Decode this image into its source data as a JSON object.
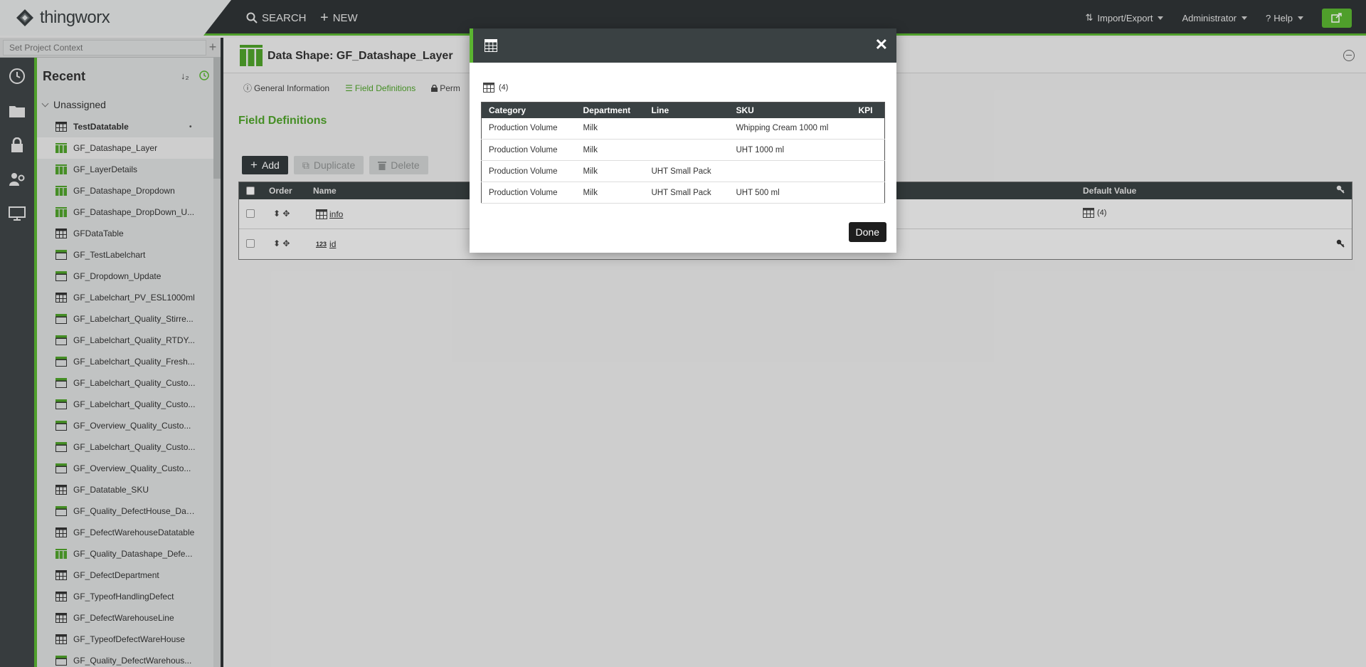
{
  "topbar": {
    "brand": "thingworx",
    "search_label": "SEARCH",
    "new_label": "NEW",
    "import_export_label": "Import/Export",
    "user_label": "Administrator",
    "help_label": "Help",
    "accent_color": "#5bb531"
  },
  "context": {
    "placeholder": "Set Project Context"
  },
  "recent": {
    "title": "Recent",
    "sort_label": "↓₂",
    "group_label": "Unassigned",
    "items": [
      {
        "label": "TestDatatable",
        "icon": "table-icon",
        "bold": true
      },
      {
        "label": "GF_Datashape_Layer",
        "icon": "datashape-icon",
        "selected": true
      },
      {
        "label": "GF_LayerDetails",
        "icon": "datashape-icon"
      },
      {
        "label": "GF_Datashape_Dropdown",
        "icon": "datashape-icon"
      },
      {
        "label": "GF_Datashape_DropDown_U...",
        "icon": "datashape-icon"
      },
      {
        "label": "GFDataTable",
        "icon": "table-icon"
      },
      {
        "label": "GF_TestLabelchart",
        "icon": "stream-icon"
      },
      {
        "label": "GF_Dropdown_Update",
        "icon": "stream-icon"
      },
      {
        "label": "GF_Labelchart_PV_ESL1000ml",
        "icon": "table-icon"
      },
      {
        "label": "GF_Labelchart_Quality_Stirre...",
        "icon": "stream-icon"
      },
      {
        "label": "GF_Labelchart_Quality_RTDY...",
        "icon": "stream-icon"
      },
      {
        "label": "GF_Labelchart_Quality_Fresh...",
        "icon": "stream-icon"
      },
      {
        "label": "GF_Labelchart_Quality_Custo...",
        "icon": "stream-icon"
      },
      {
        "label": "GF_Labelchart_Quality_Custo...",
        "icon": "stream-icon"
      },
      {
        "label": "GF_Overview_Quality_Custo...",
        "icon": "stream-icon"
      },
      {
        "label": "GF_Labelchart_Quality_Custo...",
        "icon": "stream-icon"
      },
      {
        "label": "GF_Overview_Quality_Custo...",
        "icon": "stream-icon"
      },
      {
        "label": "GF_Datatable_SKU",
        "icon": "table-icon"
      },
      {
        "label": "GF_Quality_DefectHouse_Dat...",
        "icon": "stream-icon"
      },
      {
        "label": "GF_DefectWarehouseDatatable",
        "icon": "table-icon"
      },
      {
        "label": "GF_Quality_Datashape_Defe...",
        "icon": "datashape-icon"
      },
      {
        "label": "GF_DefectDepartment",
        "icon": "table-icon"
      },
      {
        "label": "GF_TypeofHandlingDefect",
        "icon": "table-icon"
      },
      {
        "label": "GF_DefectWarehouseLine",
        "icon": "table-icon"
      },
      {
        "label": "GF_TypeofDefectWareHouse",
        "icon": "table-icon"
      },
      {
        "label": "GF_Quality_DefectWarehous...",
        "icon": "stream-icon"
      }
    ]
  },
  "entity": {
    "title": "Data Shape: GF_Datashape_Layer",
    "tabs": [
      {
        "label": "General Information",
        "icon": "info-icon"
      },
      {
        "label": "Field Definitions",
        "icon": "list-icon",
        "active": true
      },
      {
        "label": "Perm",
        "icon": "lock-icon"
      }
    ],
    "section_title": "Field Definitions",
    "toolbar": {
      "add_label": "Add",
      "duplicate_label": "Duplicate",
      "delete_label": "Delete"
    },
    "grid": {
      "headers": {
        "order": "Order",
        "name": "Name",
        "default": "Default Value"
      },
      "rows": [
        {
          "type_icon": "table-icon",
          "name": "info",
          "default": "(4)"
        },
        {
          "type_icon": "number-icon",
          "type_label": "123",
          "name": "id",
          "default": ""
        }
      ]
    }
  },
  "modal": {
    "count": "(4)",
    "columns": [
      "Category",
      "Department",
      "Line",
      "SKU",
      "KPI"
    ],
    "rows": [
      [
        "Production Volume",
        "Milk",
        "",
        "Whipping Cream 1000 ml",
        ""
      ],
      [
        "Production Volume",
        "Milk",
        "",
        "UHT 1000 ml",
        ""
      ],
      [
        "Production Volume",
        "Milk",
        "UHT Small Pack",
        "",
        ""
      ],
      [
        "Production Volume",
        "Milk",
        "UHT Small Pack",
        "UHT 500 ml",
        ""
      ]
    ],
    "done_label": "Done",
    "close_label": "✕"
  }
}
